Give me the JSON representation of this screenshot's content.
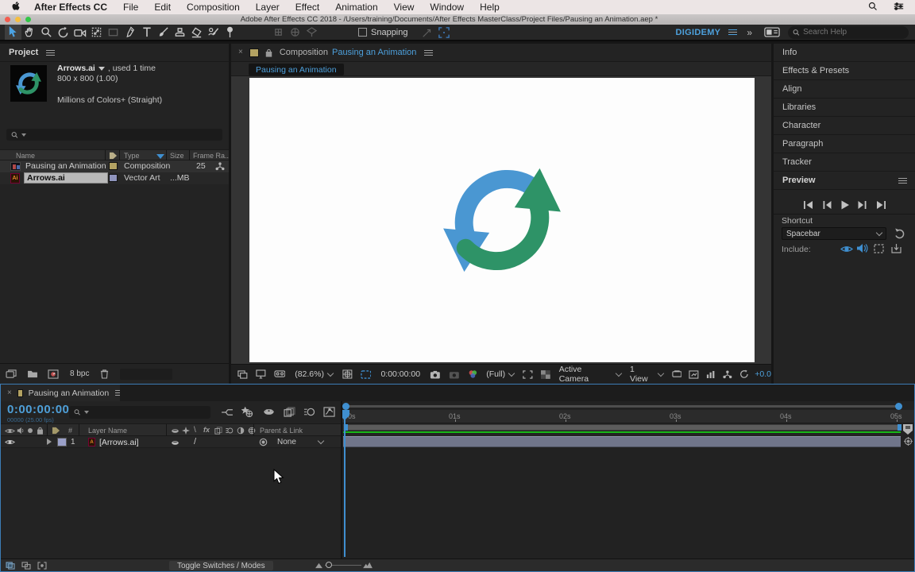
{
  "window": {
    "title": "Adobe After Effects CC 2018 - /Users/training/Documents/After Effects MasterClass/Project Files/Pausing an Animation.aep *"
  },
  "menu_bar": {
    "app_menu": "After Effects CC",
    "items": [
      "File",
      "Edit",
      "Composition",
      "Layer",
      "Effect",
      "Animation",
      "View",
      "Window",
      "Help"
    ]
  },
  "toolbar": {
    "snapping_label": "Snapping",
    "workspace_label": "DIGIDEMY",
    "search_placeholder": "Search Help"
  },
  "project_panel": {
    "title": "Project",
    "selected_item": {
      "name": "Arrows.ai",
      "usage": ", used 1 time",
      "dimensions": "800 x 800 (1.00)",
      "color_info": "Millions of Colors+ (Straight)"
    },
    "columns": {
      "name": "Name",
      "type": "Type",
      "size": "Size",
      "frame_rate": "Frame Ra.."
    },
    "rows": [
      {
        "name": "Pausing an Animation",
        "type": "Composition",
        "frame_rate": "25",
        "size": ""
      },
      {
        "name": "Arrows.ai",
        "type": "Vector Art",
        "frame_rate": "",
        "size": "...MB"
      }
    ],
    "footer": {
      "bpc": "8 bpc"
    }
  },
  "comp_panel": {
    "tab_label": "Composition",
    "tab_name": "Pausing an Animation",
    "viewer_tab": "Pausing an Animation",
    "magnification": "(82.6%)",
    "current_time": "0:00:00:00",
    "resolution": "(Full)",
    "camera": "Active Camera",
    "views": "1 View",
    "exposure": "+0.0"
  },
  "sidebar": {
    "panels": [
      "Info",
      "Effects & Presets",
      "Align",
      "Libraries",
      "Character",
      "Paragraph",
      "Tracker"
    ],
    "preview": {
      "title": "Preview",
      "shortcut_label": "Shortcut",
      "shortcut_value": "Spacebar",
      "include_label": "Include:"
    }
  },
  "timeline": {
    "tab_name": "Pausing an Animation",
    "current_time": "0:00:00:00",
    "frame_info": "00000 (25.00 fps)",
    "headers": {
      "number": "#",
      "layer_name": "Layer Name",
      "parent_link": "Parent & Link"
    },
    "layers": [
      {
        "index": "1",
        "name": "[Arrows.ai]",
        "parent": "None"
      }
    ],
    "ruler_labels": [
      "0s",
      "01s",
      "02s",
      "03s",
      "04s",
      "05s"
    ],
    "toggle_button": "Toggle Switches / Modes"
  },
  "colors": {
    "accent_blue": "#3d9bd5",
    "cache_green": "#18b818",
    "logo_blue": "#4a97d2",
    "logo_green": "#2e9367",
    "label_lavender": "#9aa0c8",
    "label_khaki": "#b3a262"
  }
}
